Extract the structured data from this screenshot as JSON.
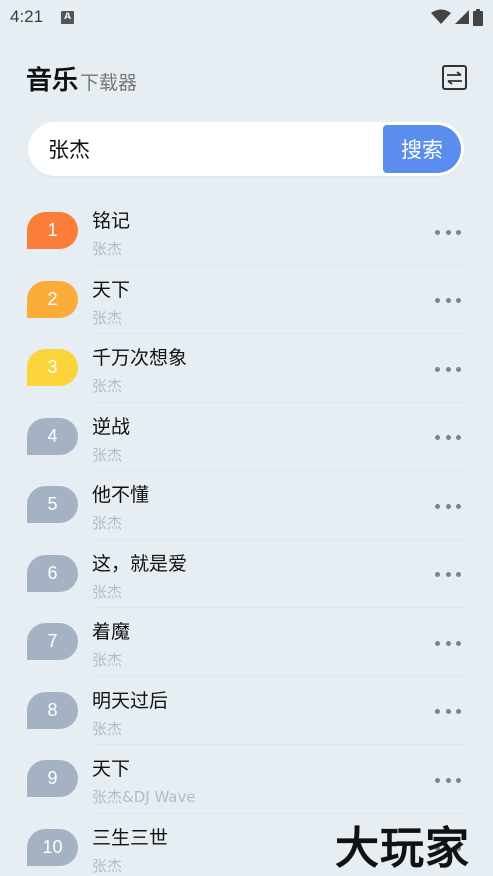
{
  "status_bar": {
    "time": "4:21",
    "notification_icon": "A"
  },
  "header": {
    "title": "音乐",
    "subtitle": "下载器",
    "switch_icon": "swap-icon"
  },
  "search": {
    "value": "张杰",
    "button_label": "搜索"
  },
  "colors": {
    "accent": "#5b8def",
    "rank1": "#fb7d3a",
    "rank2": "#fbad3b",
    "rank3": "#fbd33a",
    "rank_other": "#a4b2c3"
  },
  "songs": [
    {
      "rank": "1",
      "title": "铭记",
      "artist": "张杰"
    },
    {
      "rank": "2",
      "title": "天下",
      "artist": "张杰"
    },
    {
      "rank": "3",
      "title": "千万次想象",
      "artist": "张杰"
    },
    {
      "rank": "4",
      "title": "逆战",
      "artist": "张杰"
    },
    {
      "rank": "5",
      "title": "他不懂",
      "artist": "张杰"
    },
    {
      "rank": "6",
      "title": "这，就是爱",
      "artist": "张杰"
    },
    {
      "rank": "7",
      "title": "着魔",
      "artist": "张杰"
    },
    {
      "rank": "8",
      "title": "明天过后",
      "artist": "张杰"
    },
    {
      "rank": "9",
      "title": "天下",
      "artist": "张杰&DJ Wave"
    },
    {
      "rank": "10",
      "title": "三生三世",
      "artist": "张杰"
    }
  ],
  "watermark": "大玩家"
}
